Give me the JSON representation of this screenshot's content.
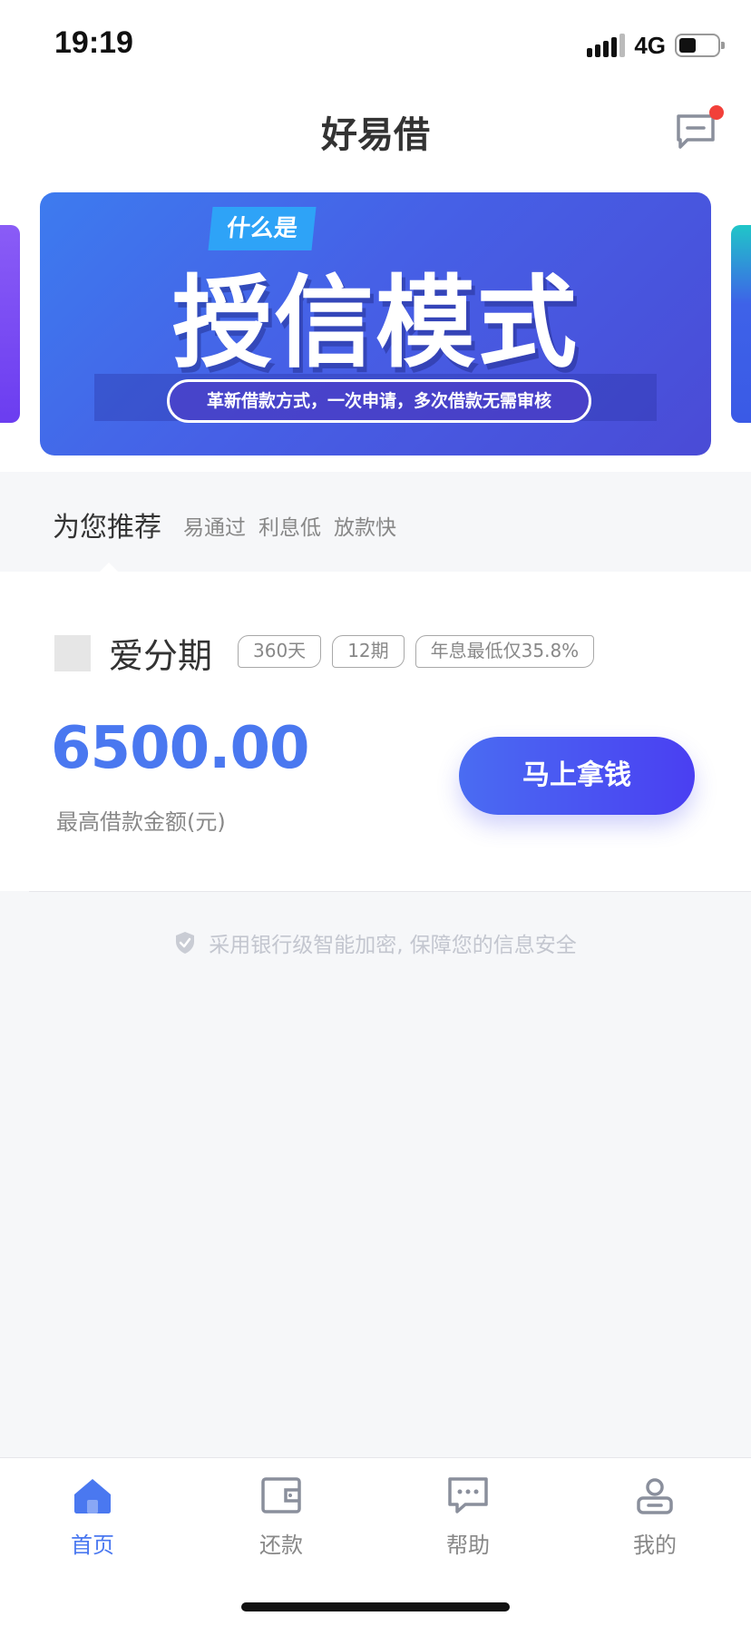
{
  "status_bar": {
    "time": "19:19",
    "network": "4G",
    "battery_level": 0.45
  },
  "nav": {
    "title": "好易借",
    "message_icon": "message-icon",
    "has_unread": true
  },
  "banner": {
    "tag": "什么是",
    "headline": "授信模式",
    "subtitle": "革新借款方式，一次申请，多次借款无需审核"
  },
  "recommend": {
    "title": "为您推荐",
    "tags": [
      "易通过",
      "利息低",
      "放款快"
    ]
  },
  "product": {
    "name": "爱分期",
    "badges": [
      "360天",
      "12期",
      "年息最低仅35.8%"
    ],
    "amount": "6500.00",
    "amount_label": "最高借款金额(元)",
    "cta_label": "马上拿钱"
  },
  "secure_note": {
    "icon": "shield-check-icon",
    "text": "采用银行级智能加密, 保障您的信息安全"
  },
  "tab_bar": {
    "items": [
      {
        "label": "首页",
        "icon": "home-icon",
        "active": true
      },
      {
        "label": "还款",
        "icon": "wallet-icon",
        "active": false
      },
      {
        "label": "帮助",
        "icon": "chat-icon",
        "active": false
      },
      {
        "label": "我的",
        "icon": "user-icon",
        "active": false
      }
    ]
  },
  "colors": {
    "accent": "#4a78f0",
    "cta_start": "#4a6cf2",
    "cta_end": "#4a3ff2",
    "badge_red": "#f2403a"
  }
}
